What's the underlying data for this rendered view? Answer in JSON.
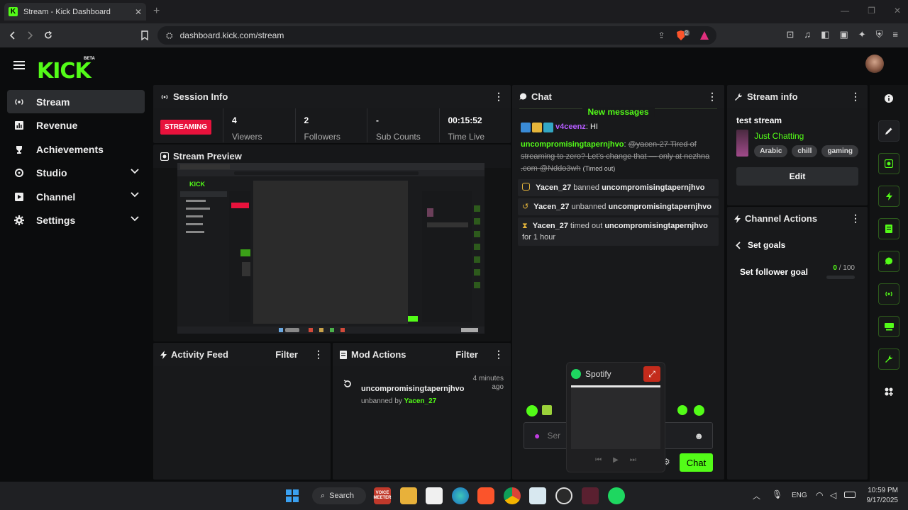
{
  "browser": {
    "tab_title": "Stream - Kick Dashboard",
    "url": "dashboard.kick.com/stream",
    "brave_badge": "2"
  },
  "app": {
    "logo_text": "KICK",
    "logo_badge": "BETA",
    "accent_color": "#53fc18"
  },
  "sidebar": {
    "items": [
      {
        "label": "Stream",
        "icon": "broadcast-icon",
        "active": true
      },
      {
        "label": "Revenue",
        "icon": "chart-icon"
      },
      {
        "label": "Achievements",
        "icon": "trophy-icon"
      },
      {
        "label": "Studio",
        "icon": "studio-icon",
        "expandable": true
      },
      {
        "label": "Channel",
        "icon": "channel-icon",
        "expandable": true
      },
      {
        "label": "Settings",
        "icon": "gear-icon",
        "expandable": true
      }
    ]
  },
  "session": {
    "title": "Session Info",
    "status": "STREAMING",
    "stats": [
      {
        "value": "4",
        "label": "Viewers"
      },
      {
        "value": "2",
        "label": "Followers"
      },
      {
        "value": "-",
        "label": "Sub Counts"
      },
      {
        "value": "00:15:52",
        "label": "Time Live"
      }
    ]
  },
  "preview": {
    "title": "Stream Preview"
  },
  "activity": {
    "title": "Activity Feed",
    "filter": "Filter"
  },
  "mod_actions": {
    "title": "Mod Actions",
    "filter": "Filter",
    "entry": {
      "user": "uncompromisingtapernjhvo",
      "time": "4 minutes ago",
      "action_prefix": "unbanned by",
      "actor": "Yacen_27"
    }
  },
  "chat": {
    "title": "Chat",
    "new_messages": "New messages",
    "messages": [
      {
        "user": "v4ceenz",
        "text": "HI"
      },
      {
        "user": "uncompromisingtapernjhvo",
        "text": "@yacen-27 Tired of streaming to zero? Let's change that — only at nezhna .com @Nddo3wh",
        "note": "(Timed out)"
      }
    ],
    "mod_events": [
      {
        "actor": "Yacen_27",
        "verb": "banned",
        "target": "uncompromisingtapernjhvo",
        "suffix": ""
      },
      {
        "actor": "Yacen_27",
        "verb": "unbanned",
        "target": "uncompromisingtapernjhvo",
        "suffix": ""
      },
      {
        "actor": "Yacen_27",
        "verb": "timed out",
        "target": "uncompromisingtapernjhvo",
        "suffix": "for 1 hour"
      }
    ],
    "input_placeholder": "Ser",
    "send_label": "Chat"
  },
  "spotify": {
    "title": "Spotify"
  },
  "stream_info": {
    "title": "Stream info",
    "stream_title": "test stream",
    "category": "Just Chatting",
    "tags": [
      "Arabic",
      "chill",
      "gaming"
    ],
    "edit_label": "Edit"
  },
  "channel_actions": {
    "title": "Channel Actions",
    "back_label": "Set goals",
    "goal_label": "Set follower goal",
    "goal_current": "0",
    "goal_total": "/ 100",
    "goal_progress": 0
  },
  "taskbar": {
    "search_label": "Search",
    "voicemeeter_label": "VOICE MEETER",
    "lang": "ENG",
    "time": "10:59 PM",
    "date": "9/17/2025"
  }
}
